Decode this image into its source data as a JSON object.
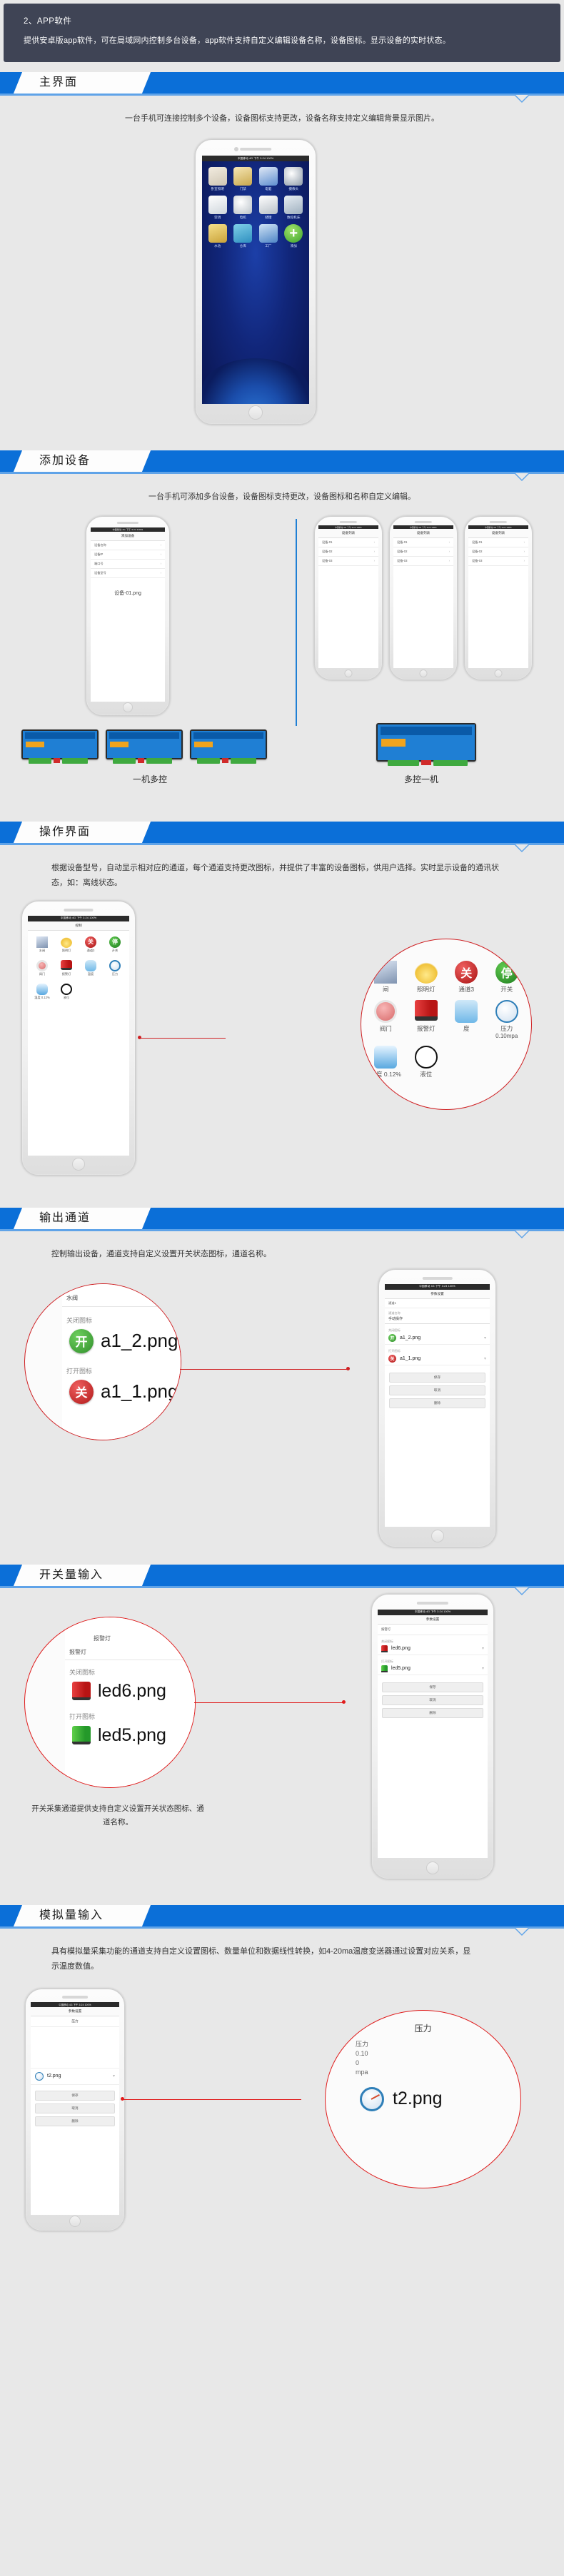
{
  "intro": {
    "title": "2、APP软件",
    "body": "提供安卓版app软件，可在局域网内控制多台设备，app软件支持自定义编辑设备名称，设备图标。显示设备的实时状态。"
  },
  "sections": [
    {
      "id": "main-interface",
      "title": "主界面",
      "desc": "一台手机可连接控制多个设备，设备图标支持更改，设备名称支持定义编辑背景显示图片。"
    },
    {
      "id": "add-device",
      "title": "添加设备",
      "desc": "一台手机可添加多台设备，设备图标支持更改，设备图标和名称自定义编辑。"
    },
    {
      "id": "operation-interface",
      "title": "操作界面",
      "desc": "根据设备型号，自动显示相对应的通道，每个通道支持更改图标，并提供了丰富的设备图标，供用户选择。实时显示设备的通讯状态，如：离线状态。"
    },
    {
      "id": "output-channel",
      "title": "输出通道",
      "desc": "控制输出设备，通道支持自定义设置开关状态图标，通道名称。"
    },
    {
      "id": "switch-input",
      "title": "开关量输入",
      "desc": "开关采集通道提供支持自定义设置开关状态图标、通道名称。"
    },
    {
      "id": "analog-input",
      "title": "模拟量输入",
      "desc": "具有模拟量采集功能的通道支持自定义设置图标、数量单位和数据线性转换，如4-20ma温度变送器通过设置对应关系，显示温度数值。"
    }
  ],
  "main_phone": {
    "statusbar": "中国移动 4G    下午 3:24      100%",
    "apps": [
      {
        "label": "卧室照明",
        "icon": "bed-icon"
      },
      {
        "label": "门禁",
        "icon": "door-icon"
      },
      {
        "label": "电脑",
        "icon": "computer-icon"
      },
      {
        "label": "摄像头",
        "icon": "camera-icon"
      },
      {
        "label": "空调",
        "icon": "air-conditioner-icon"
      },
      {
        "label": "电机",
        "icon": "motor-icon"
      },
      {
        "label": "储罐",
        "icon": "tank-icon"
      },
      {
        "label": "数控机床",
        "icon": "cnc-machine-icon"
      },
      {
        "label": "水池",
        "icon": "pool-icon"
      },
      {
        "label": "仓库",
        "icon": "warehouse-icon"
      },
      {
        "label": "工厂",
        "icon": "factory-icon"
      },
      {
        "label": "添加",
        "icon": "add-plus-icon"
      }
    ]
  },
  "add_device": {
    "left_phone": {
      "statusbar": "中国移动 4G    下午 3:24      100%",
      "title": "添加设备",
      "rows": [
        {
          "label": "设备名称",
          "value": ""
        },
        {
          "label": "设备IP",
          "value": ""
        },
        {
          "label": "端口号",
          "value": ""
        },
        {
          "label": "设备型号",
          "value": ""
        }
      ],
      "big_text": "设备-01.png"
    },
    "right_phones": [
      {
        "statusbar": "中国移动 4G    下午 3:24      100%",
        "title": "设备列表",
        "rows": [
          "设备-01",
          "设备-02",
          "设备-03"
        ]
      },
      {
        "statusbar": "中国移动 4G    下午 3:24      100%",
        "title": "设备列表",
        "rows": [
          "设备-01",
          "设备-02",
          "设备-03"
        ]
      },
      {
        "statusbar": "中国移动 4G    下午 3:24      100%",
        "title": "设备列表",
        "rows": [
          "设备-01",
          "设备-02",
          "设备-03"
        ]
      }
    ],
    "caption_left": "一机多控",
    "caption_right": "多控一机"
  },
  "operation": {
    "phone": {
      "statusbar": "中国移动 4G    下午 3:24      100%",
      "title": "控制",
      "channels": [
        {
          "label": "水阀",
          "state": "on"
        },
        {
          "label": "照明灯",
          "state": "on"
        },
        {
          "label": "通道3",
          "state": "关"
        },
        {
          "label": "开关",
          "state": "停"
        },
        {
          "label": "阀门",
          "state": "off"
        },
        {
          "label": "报警灯",
          "state": "on"
        },
        {
          "label": "温度",
          "state": "--"
        },
        {
          "label": "压力",
          "state": "0.10mpa"
        },
        {
          "label": "湿度 0.12%",
          "state": "--"
        },
        {
          "label": "液位",
          "state": "--"
        }
      ]
    },
    "magnifier": {
      "items": [
        {
          "label": "闸",
          "icon": "gate-icon"
        },
        {
          "label": "照明灯",
          "icon": "bulb-icon"
        },
        {
          "label": "通道3",
          "icon": "close-red-button-icon",
          "badge": "关"
        },
        {
          "label": "开关",
          "icon": "stop-green-button-icon",
          "badge": "停"
        },
        {
          "label": "阀门",
          "icon": "valve-icon"
        },
        {
          "label": "报警灯",
          "icon": "alarm-lamp-icon"
        },
        {
          "label": "度",
          "icon": "thermometer-icon"
        },
        {
          "label": "压力",
          "value": "0.10mpa",
          "icon": "pressure-gauge-icon"
        },
        {
          "label": "湿度 0.12%",
          "icon": "humidity-icon"
        },
        {
          "label": "液位",
          "icon": "level-gauge-icon"
        }
      ]
    }
  },
  "output_channel": {
    "magnifier": {
      "header": "水阀",
      "off_label": "关闭图标",
      "off_file": "a1_2.png",
      "off_badge": "开",
      "on_label": "打开图标",
      "on_file": "a1_1.png",
      "on_badge": "关"
    },
    "phone": {
      "statusbar": "中国移动 4G    下午 3:24      100%",
      "title": "参数设置",
      "sub": "通道1",
      "field_label": "通道名称",
      "field_value": "手动操作",
      "off_label": "关闭图标",
      "off_file": "a1_2.png",
      "on_label": "打开图标",
      "on_file": "a1_1.png",
      "buttons": [
        "保存",
        "取消",
        "删除"
      ]
    }
  },
  "switch_input": {
    "magnifier": {
      "header": "报警灯",
      "sub": "报警灯",
      "off_label": "关闭图标",
      "off_file": "led6.png",
      "on_label": "打开图标",
      "on_file": "led5.png"
    },
    "phone": {
      "statusbar": "中国移动 4G    下午 3:24      100%",
      "title": "参数设置",
      "sub": "报警灯",
      "field_label": "通道名称",
      "off_label": "关闭图标",
      "off_file": "led6.png",
      "on_label": "打开图标",
      "on_file": "led5.png",
      "buttons": [
        "保存",
        "取消",
        "删除"
      ]
    }
  },
  "analog_input": {
    "phone": {
      "statusbar": "中国移动 4G    下午 3:24      100%",
      "title": "参数设置",
      "sub": "压力",
      "file": "t2.png",
      "buttons": [
        "保存",
        "取消",
        "删除"
      ]
    },
    "magnifier": {
      "header": "压力",
      "fields": [
        "压力",
        "0.10",
        "0",
        "mpa"
      ],
      "file": "t2.png"
    }
  },
  "colors": {
    "brand_blue": "#0b6fd8",
    "rule_blue": "#5fa3e8",
    "intro_bg": "#3f4455",
    "page_bg": "#e8e8e8",
    "accent_red": "#cf1f22",
    "green": "#3fa93f"
  }
}
